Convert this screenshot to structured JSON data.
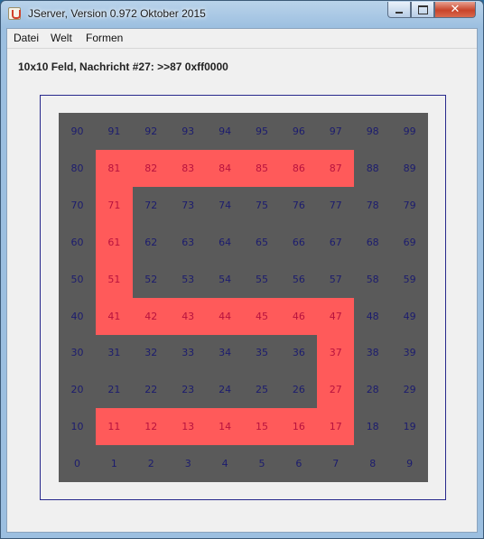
{
  "window": {
    "title": "JServer, Version 0.972 Oktober 2015",
    "icon": "java-cup-icon",
    "controls": {
      "minimize_icon": "minimize-icon",
      "maximize_icon": "maximize-icon",
      "close_icon": "close-icon"
    }
  },
  "menu": {
    "items": [
      {
        "label": "Datei"
      },
      {
        "label": "Welt"
      },
      {
        "label": "Formen"
      }
    ]
  },
  "status": {
    "message": "10x10 Feld, Nachricht #27: >>87 0xff0000"
  },
  "board": {
    "rows": 10,
    "cols": 10,
    "highlighted_cells": [
      11,
      12,
      13,
      14,
      15,
      16,
      17,
      27,
      37,
      47,
      46,
      45,
      44,
      43,
      42,
      41,
      51,
      61,
      71,
      81,
      82,
      83,
      84,
      85,
      86,
      87
    ],
    "colors": {
      "board_background": "#5a5a5a",
      "highlight": "#ff5a5a",
      "number_text": "#1c1c6e",
      "highlight_text": "#b8123e",
      "frame_border": "#27288c"
    }
  }
}
